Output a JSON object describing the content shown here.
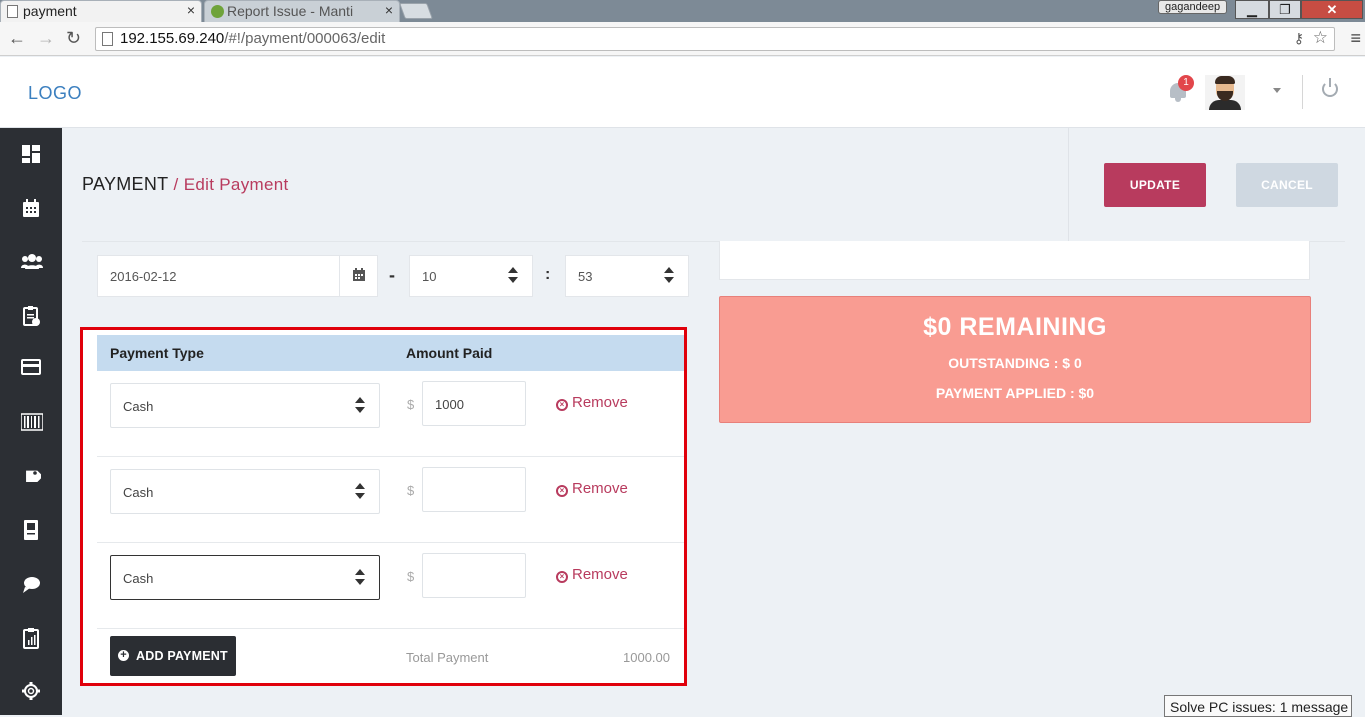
{
  "browser": {
    "tabs": [
      {
        "title": "payment",
        "close": "×"
      },
      {
        "title": "Report Issue - Manti",
        "close": "×"
      }
    ],
    "user_badge": "gagandeep",
    "window_buttons": {
      "minimize": "▁",
      "maximize": "❐",
      "close": "✕"
    },
    "nav": {
      "back": "←",
      "forward": "→",
      "reload": "↻"
    },
    "url_host": "192.155.69.240",
    "url_path": "/#!/payment/000063/edit",
    "menu": "≡"
  },
  "header": {
    "logo": "LOGO",
    "notification_count": "1"
  },
  "page": {
    "breadcrumb_root": "PAYMENT",
    "breadcrumb_sep": "/",
    "breadcrumb_current": "Edit Payment",
    "update_label": "UPDATE",
    "cancel_label": "CANCEL"
  },
  "datetime": {
    "date": "2016-02-12",
    "hour": "10",
    "minute": "53",
    "dash": "-",
    "colon": ":"
  },
  "payments": {
    "col_type": "Payment Type",
    "col_amount": "Amount Paid",
    "currency": "$",
    "remove_label": "Remove",
    "rows": [
      {
        "type": "Cash",
        "amount": "1000"
      },
      {
        "type": "Cash",
        "amount": ""
      },
      {
        "type": "Cash",
        "amount": ""
      }
    ],
    "add_label": "ADD PAYMENT",
    "total_label": "Total Payment",
    "total_value": "1000.00"
  },
  "summary": {
    "remaining": "$0 REMAINING",
    "outstanding": "OUTSTANDING : $ 0",
    "applied": "PAYMENT APPLIED : $0"
  },
  "toast": "Solve PC issues: 1 message",
  "colors": {
    "accent": "#b83b5e",
    "remaining_bg": "#f99c92",
    "sidebar": "#2c2f34",
    "highlight": "#e0000b"
  }
}
